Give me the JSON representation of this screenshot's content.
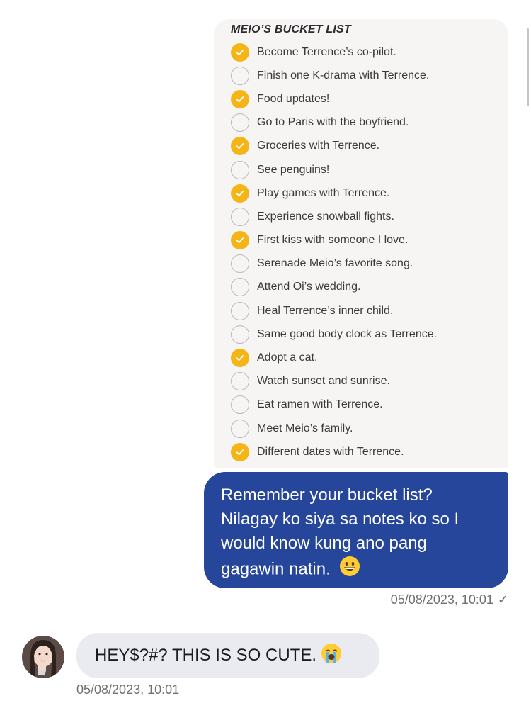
{
  "notes": {
    "title": "MEIO’S BUCKET LIST",
    "items": [
      {
        "text": "Become Terrence’s co-pilot.",
        "checked": true
      },
      {
        "text": "Finish one K-drama with Terrence.",
        "checked": false
      },
      {
        "text": "Food updates!",
        "checked": true
      },
      {
        "text": "Go to Paris with the boyfriend.",
        "checked": false
      },
      {
        "text": "Groceries with Terrence.",
        "checked": true
      },
      {
        "text": "See penguins!",
        "checked": false
      },
      {
        "text": "Play games with Terrence.",
        "checked": true
      },
      {
        "text": "Experience snowball fights.",
        "checked": false
      },
      {
        "text": "First kiss with someone I love.",
        "checked": true
      },
      {
        "text": "Serenade Meio’s favorite song.",
        "checked": false
      },
      {
        "text": "Attend Oi’s wedding.",
        "checked": false
      },
      {
        "text": "Heal Terrence’s inner child.",
        "checked": false
      },
      {
        "text": "Same good body clock as Terrence.",
        "checked": false
      },
      {
        "text": "Adopt a cat.",
        "checked": true
      },
      {
        "text": "Watch sunset and sunrise.",
        "checked": false
      },
      {
        "text": "Eat ramen with Terrence.",
        "checked": false
      },
      {
        "text": "Meet Meio’s family.",
        "checked": false
      },
      {
        "text": "Different dates with Terrence.",
        "checked": true
      }
    ]
  },
  "sent": {
    "text": "Remember your bucket list? Nilagay ko siya sa notes ko so I would know kung ano pang gagawin natin.",
    "emoji": "grinning-face-emoji",
    "timestamp": "05/08/2023, 10:01",
    "status_icon": "single-check-icon"
  },
  "received": {
    "text": "HEY$?#? THIS IS SO CUTE.",
    "emoji": "loudly-crying-face-emoji",
    "timestamp": "05/08/2023, 10:01",
    "avatar": "contact-avatar"
  },
  "colors": {
    "sent_bubble": "#26469c",
    "received_bubble": "#e9ebf0",
    "checkbox_checked": "#f5b516",
    "timestamp": "#707074"
  }
}
